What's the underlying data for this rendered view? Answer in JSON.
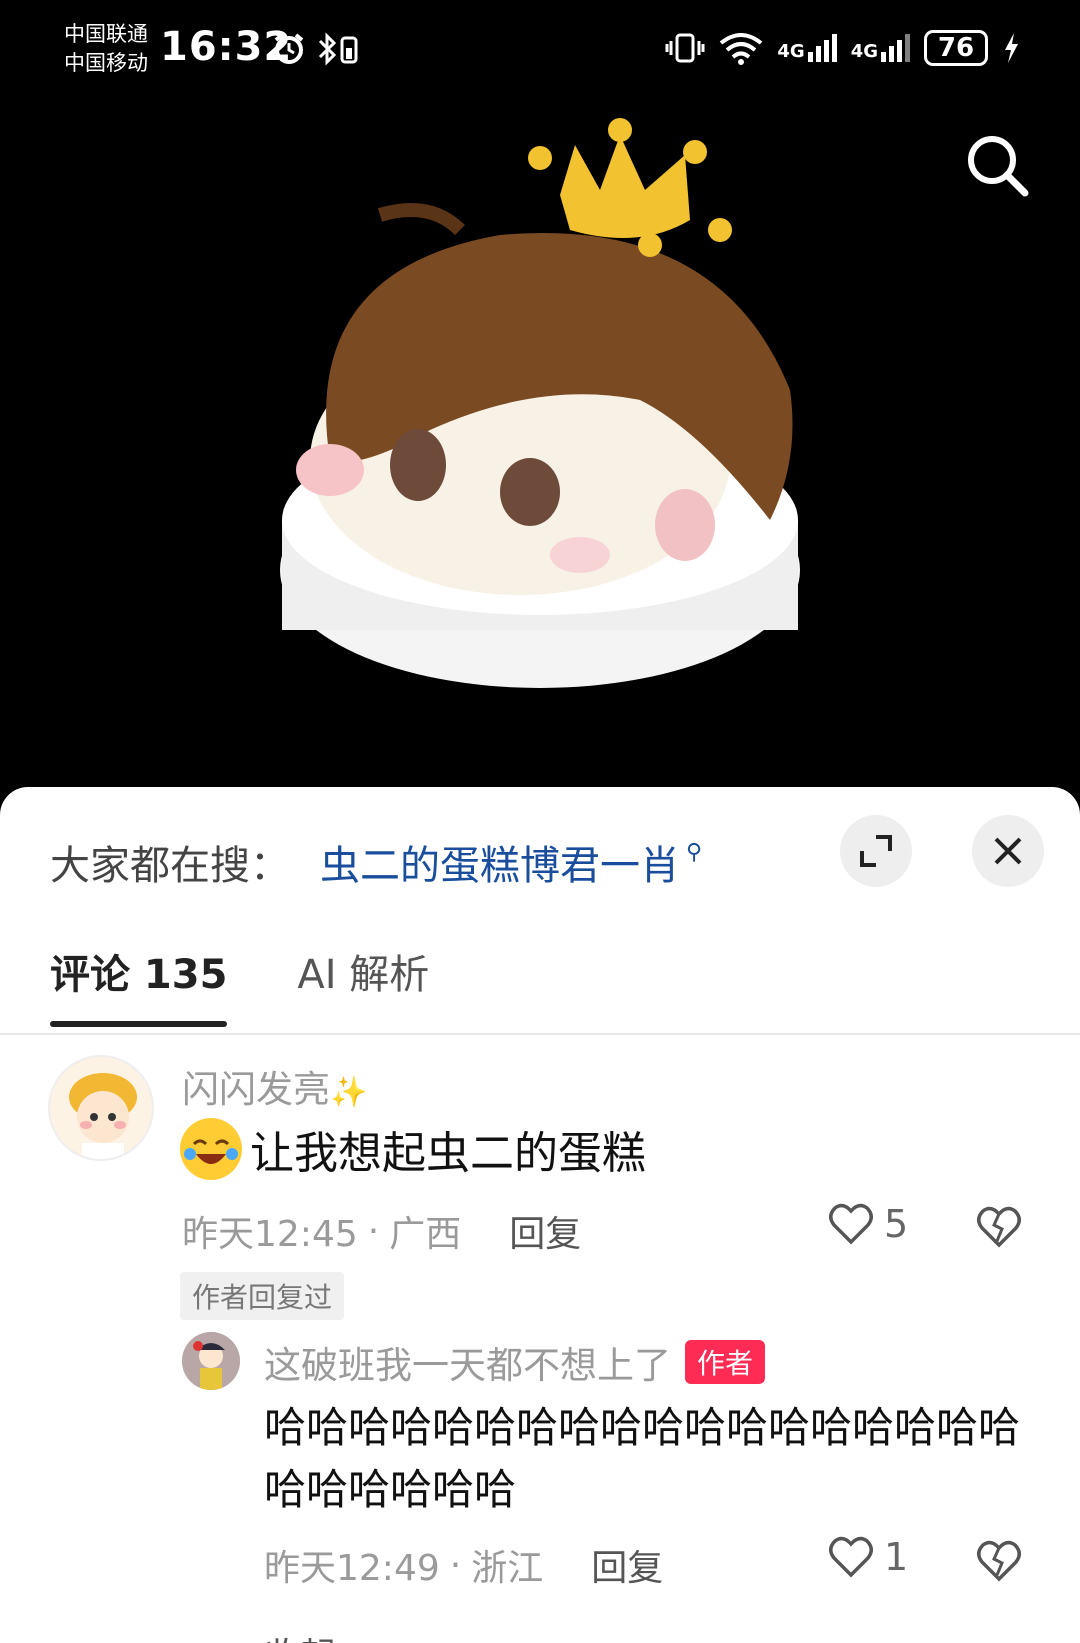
{
  "status_bar": {
    "carrier1": "中国联通",
    "carrier2": "中国移动",
    "time": "16:32",
    "battery": "76",
    "net1": "4G",
    "net2": "4G"
  },
  "search_bar": {
    "label": "大家都在搜：",
    "query": "虫二的蛋糕博君一肖"
  },
  "tabs": [
    {
      "label": "评论 135"
    },
    {
      "label": "AI 解析"
    }
  ],
  "comments": [
    {
      "username": "闪闪发亮",
      "text": "让我想起虫二的蛋糕",
      "time": "昨天12:45",
      "location": "广西",
      "reply_label": "回复",
      "likes": "5",
      "tag": "作者回复过"
    }
  ],
  "replies": [
    {
      "username": "这破班我一天都不想上了",
      "badge": "作者",
      "text": "哈哈哈哈哈哈哈哈哈哈哈哈哈哈哈哈哈哈哈哈哈哈哈哈",
      "time": "昨天12:49",
      "location": "浙江",
      "reply_label": "回复",
      "likes": "1"
    }
  ],
  "collapse_label": "收起",
  "colors": {
    "accent_link": "#1a4e9c",
    "author_badge": "#fe2c55"
  },
  "icons": [
    "search-icon",
    "expand-icon",
    "close-icon",
    "heart-icon",
    "broken-heart-icon"
  ]
}
